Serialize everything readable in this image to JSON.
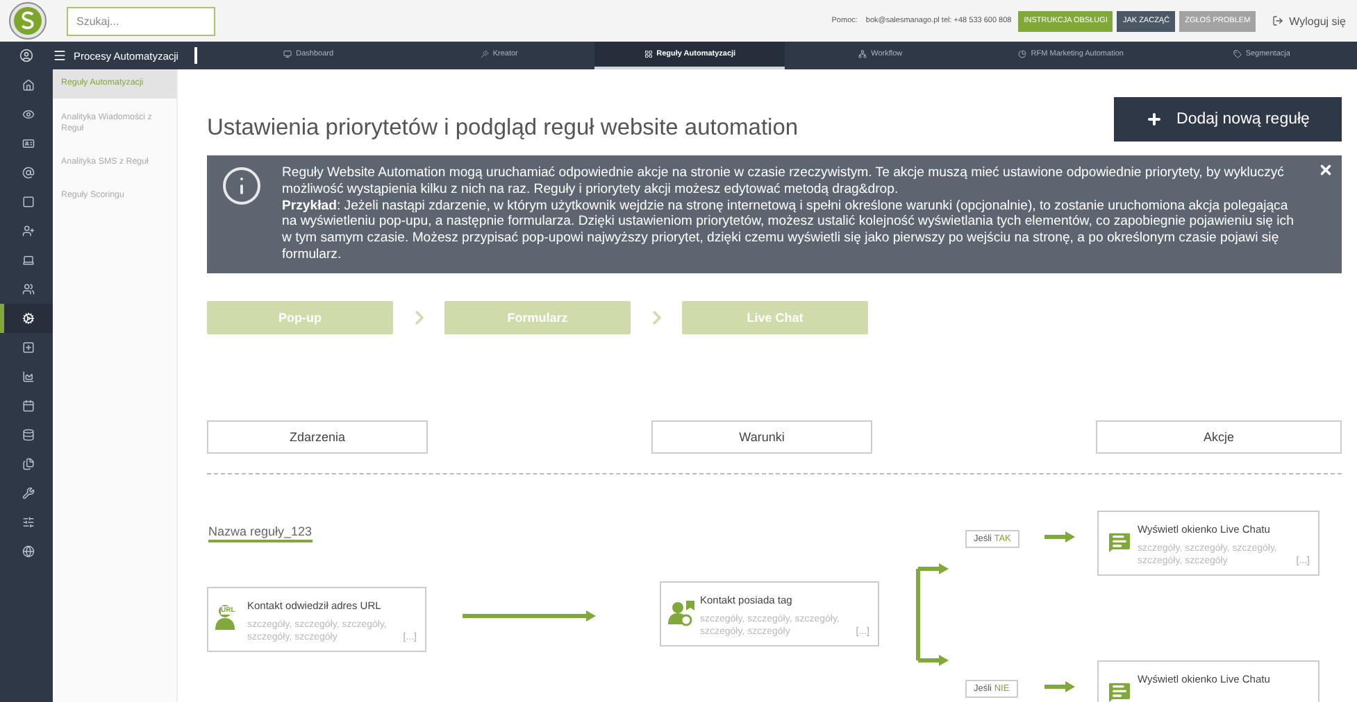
{
  "topbar": {
    "search": {
      "placeholder": "Szukaj..."
    },
    "help_label": "Pomoc:",
    "contact": "bok@salesmanago.pl tel: +48 533 600 808",
    "buttons": [
      {
        "label": "INSTRUKCJA OBSŁUGI",
        "kind": "primary"
      },
      {
        "label": "JAK ZACZĄĆ",
        "kind": "dark"
      },
      {
        "label": "ZGŁOŚ PROBLEM",
        "kind": "grey"
      }
    ],
    "logout": "Wyloguj się"
  },
  "navbar": {
    "section": "Procesy Automatyzacji",
    "tabs": [
      {
        "label": "Dashboard",
        "selected": false
      },
      {
        "label": "Kreator",
        "selected": false
      },
      {
        "label": "Reguły Automatyzacji",
        "selected": true
      },
      {
        "label": "Workflow",
        "selected": false
      },
      {
        "label": "RFM Marketing Automation",
        "selected": false
      },
      {
        "label": "Segmentacja",
        "selected": false
      }
    ]
  },
  "rail": {
    "items": [
      {
        "selected": false
      },
      {
        "selected": false
      },
      {
        "selected": false
      },
      {
        "selected": false
      },
      {
        "selected": false
      },
      {
        "selected": false
      },
      {
        "selected": false
      },
      {
        "selected": false
      },
      {
        "selected": true
      },
      {
        "selected": false
      },
      {
        "selected": false
      },
      {
        "selected": false
      },
      {
        "selected": false
      },
      {
        "selected": false
      },
      {
        "selected": false
      },
      {
        "selected": false
      },
      {
        "selected": false
      }
    ]
  },
  "submenu": {
    "items": [
      {
        "label": "Reguły Automatyzacji",
        "selected": true
      },
      {
        "label": "Analityka Wiadomości z Reguł",
        "selected": false
      },
      {
        "label": "Analityka SMS z Reguł",
        "selected": false
      },
      {
        "label": "Reguły Scoringu",
        "selected": false
      }
    ]
  },
  "page": {
    "title": "Ustawienia priorytetów i podgląd reguł website automation",
    "add_button": "Dodaj nową regułę"
  },
  "alert": {
    "paragraphs": [
      "Reguły Website Automation mogą uruchamiać odpowiednie akcje na stronie w czasie rzeczywistym. Te akcje muszą mieć ustawione odpowiednie priorytety, by wykluczyć możliwość wystąpienia kilku z nich na raz. Reguły i priorytety akcji możesz edytować metodą drag&drop.",
      "**Przykład**: Jeżeli nastąpi zdarzenie, w którym użytkownik wejdzie na stronę internetową i spełni określone warunki (opcjonalnie), to zostanie uruchomiona akcja polegająca na wyświetleniu pop-upu, a następnie formularza. Dzięki ustawieniom priorytetów, możesz ustalić kolejność wyświetlania tych elementów, co zapobiegnie pojawieniu się ich w tym samym czasie. Możesz przypisać pop-upowi najwyższy priorytet, dzięki czemu wyświetli się jako pierwszy po wejściu na stronę, a po określonym czasie pojawi się formularz."
    ]
  },
  "steps": [
    "Pop-up",
    "Formularz",
    "Live Chat"
  ],
  "columns": [
    "Zdarzenia",
    "Warunki",
    "Akcje"
  ],
  "rule": {
    "name": "Nazwa reguły_123",
    "event": {
      "title": "Kontakt odwiedził adres URL",
      "badge": "URL",
      "details": "szczegóły, szczegóły, szczegóły, szczegóły, szczegóły",
      "more": "[...]"
    },
    "condition": {
      "title": "Kontakt posiada tag",
      "details": "szczegóły, szczegóły, szczegóły, szczegóły, szczegóły",
      "more": "[...]"
    },
    "branches": [
      {
        "prefix": "Jeśli",
        "answer": "TAK",
        "action": {
          "title": "Wyświetl okienko Live Chatu",
          "details": "szczegóły, szczegóły, szczegóły, szczegóły, szczegóły",
          "more": "[...]"
        }
      },
      {
        "prefix": "Jeśli",
        "answer": "NIE",
        "action": {
          "title": "Wyświetl okienko Live Chatu"
        }
      }
    ]
  }
}
